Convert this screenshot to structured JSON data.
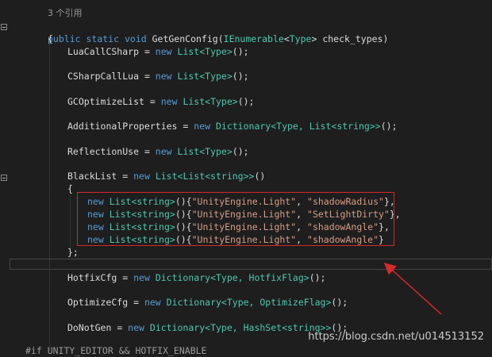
{
  "editor": {
    "code_lens": "3 个引用",
    "method_signature": {
      "kw_public": "public",
      "kw_static": "static",
      "kw_void": "void",
      "name": "GetGenConfig",
      "open": "(",
      "param_type": "IEnumerable",
      "lt": "<",
      "generic_type": "Type",
      "gt": ">",
      "param_name": "check_types",
      "close": ")"
    },
    "open_brace": "{",
    "assignments": [
      {
        "name": "LuaCallCSharp",
        "op": " = ",
        "new": "new",
        "type": "List",
        "args": "<Type>",
        "end": "();"
      },
      {
        "name": "CSharpCallLua",
        "op": " = ",
        "new": "new",
        "type": "List",
        "args": "<Type>",
        "end": "();"
      },
      {
        "name": "GCOptimizeList",
        "op": " = ",
        "new": "new",
        "type": "List",
        "args": "<Type>",
        "end": "();"
      },
      {
        "name": "AdditionalProperties",
        "op": " = ",
        "new": "new",
        "type": "Dictionary",
        "args": "<Type, List<string>>",
        "end": "();"
      },
      {
        "name": "ReflectionUse",
        "op": " = ",
        "new": "new",
        "type": "List",
        "args": "<Type>",
        "end": "();"
      }
    ],
    "blacklist": {
      "name": "BlackList",
      "op": " = ",
      "new": "new",
      "type": "List",
      "args": "<List<string>>",
      "end": "()",
      "open_brace": "{",
      "close_brace": "};",
      "entries": [
        {
          "new": "new",
          "type": "List",
          "args": "<string>",
          "parens": "(){",
          "s1": "\"UnityEngine.Light\"",
          "sep": ", ",
          "s2": "\"shadowRadius\"",
          "end": "},"
        },
        {
          "new": "new",
          "type": "List",
          "args": "<string>",
          "parens": "(){",
          "s1": "\"UnityEngine.Light\"",
          "sep": ", ",
          "s2": "\"SetLightDirty\"",
          "end": "},"
        },
        {
          "new": "new",
          "type": "List",
          "args": "<string>",
          "parens": "(){",
          "s1": "\"UnityEngine.Light\"",
          "sep": ", ",
          "s2": "\"shadowAngle\"",
          "end": "},"
        },
        {
          "new": "new",
          "type": "List",
          "args": "<string>",
          "parens": "(){",
          "s1": "\"UnityEngine.Light\"",
          "sep": ", ",
          "s2": "\"shadowAngle\"",
          "end": "}"
        }
      ]
    },
    "after": [
      {
        "name": "HotfixCfg",
        "op": " = ",
        "new": "new",
        "type": "Dictionary",
        "args": "<Type, HotfixFlag>",
        "end": "();"
      },
      {
        "name": "OptimizeCfg",
        "op": " = ",
        "new": "new",
        "type": "Dictionary",
        "args": "<Type, OptimizeFlag>",
        "end": "();"
      },
      {
        "name": "DoNotGen",
        "op": " = ",
        "new": "new",
        "type": "Dictionary",
        "args": "<Type, HashSet<string>>",
        "end": "();"
      }
    ],
    "preprocessor": "#if UNITY_EDITOR && HOTFIX_ENABLE"
  },
  "annotation": {
    "color": "#d42a2a"
  },
  "watermark": "https://blog.csdn.net/u014513152"
}
